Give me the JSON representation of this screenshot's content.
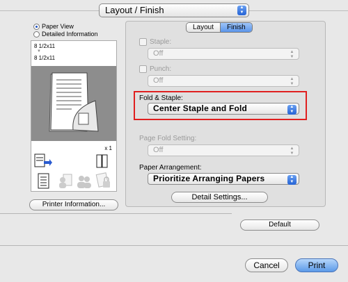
{
  "top_panel": {
    "selected": "Layout / Finish"
  },
  "preview": {
    "view_options": [
      {
        "label": "Paper View",
        "selected": true
      },
      {
        "label": "Detailed Information",
        "selected": false
      }
    ],
    "original_size": "8 1/2x11",
    "output_size": "8 1/2x11",
    "copies": "x 1",
    "printer_info_button": "Printer Information..."
  },
  "tabs": [
    {
      "label": "Layout",
      "selected": false
    },
    {
      "label": "Finish",
      "selected": true
    }
  ],
  "settings": {
    "staple": {
      "label": "Staple:",
      "value": "Off",
      "checked": false
    },
    "punch": {
      "label": "Punch:",
      "value": "Off",
      "checked": false
    },
    "fold_staple": {
      "label": "Fold & Staple:",
      "value": "Center Staple and Fold"
    },
    "page_fold": {
      "label": "Page Fold Setting:",
      "value": "Off"
    },
    "paper_arrangement": {
      "label": "Paper Arrangement:",
      "value": "Prioritize Arranging Papers"
    },
    "detail_button": "Detail Settings..."
  },
  "buttons": {
    "default": "Default",
    "cancel": "Cancel",
    "print": "Print"
  },
  "colors": {
    "highlight": "#e01f1f",
    "accent": "#3b78e0"
  }
}
